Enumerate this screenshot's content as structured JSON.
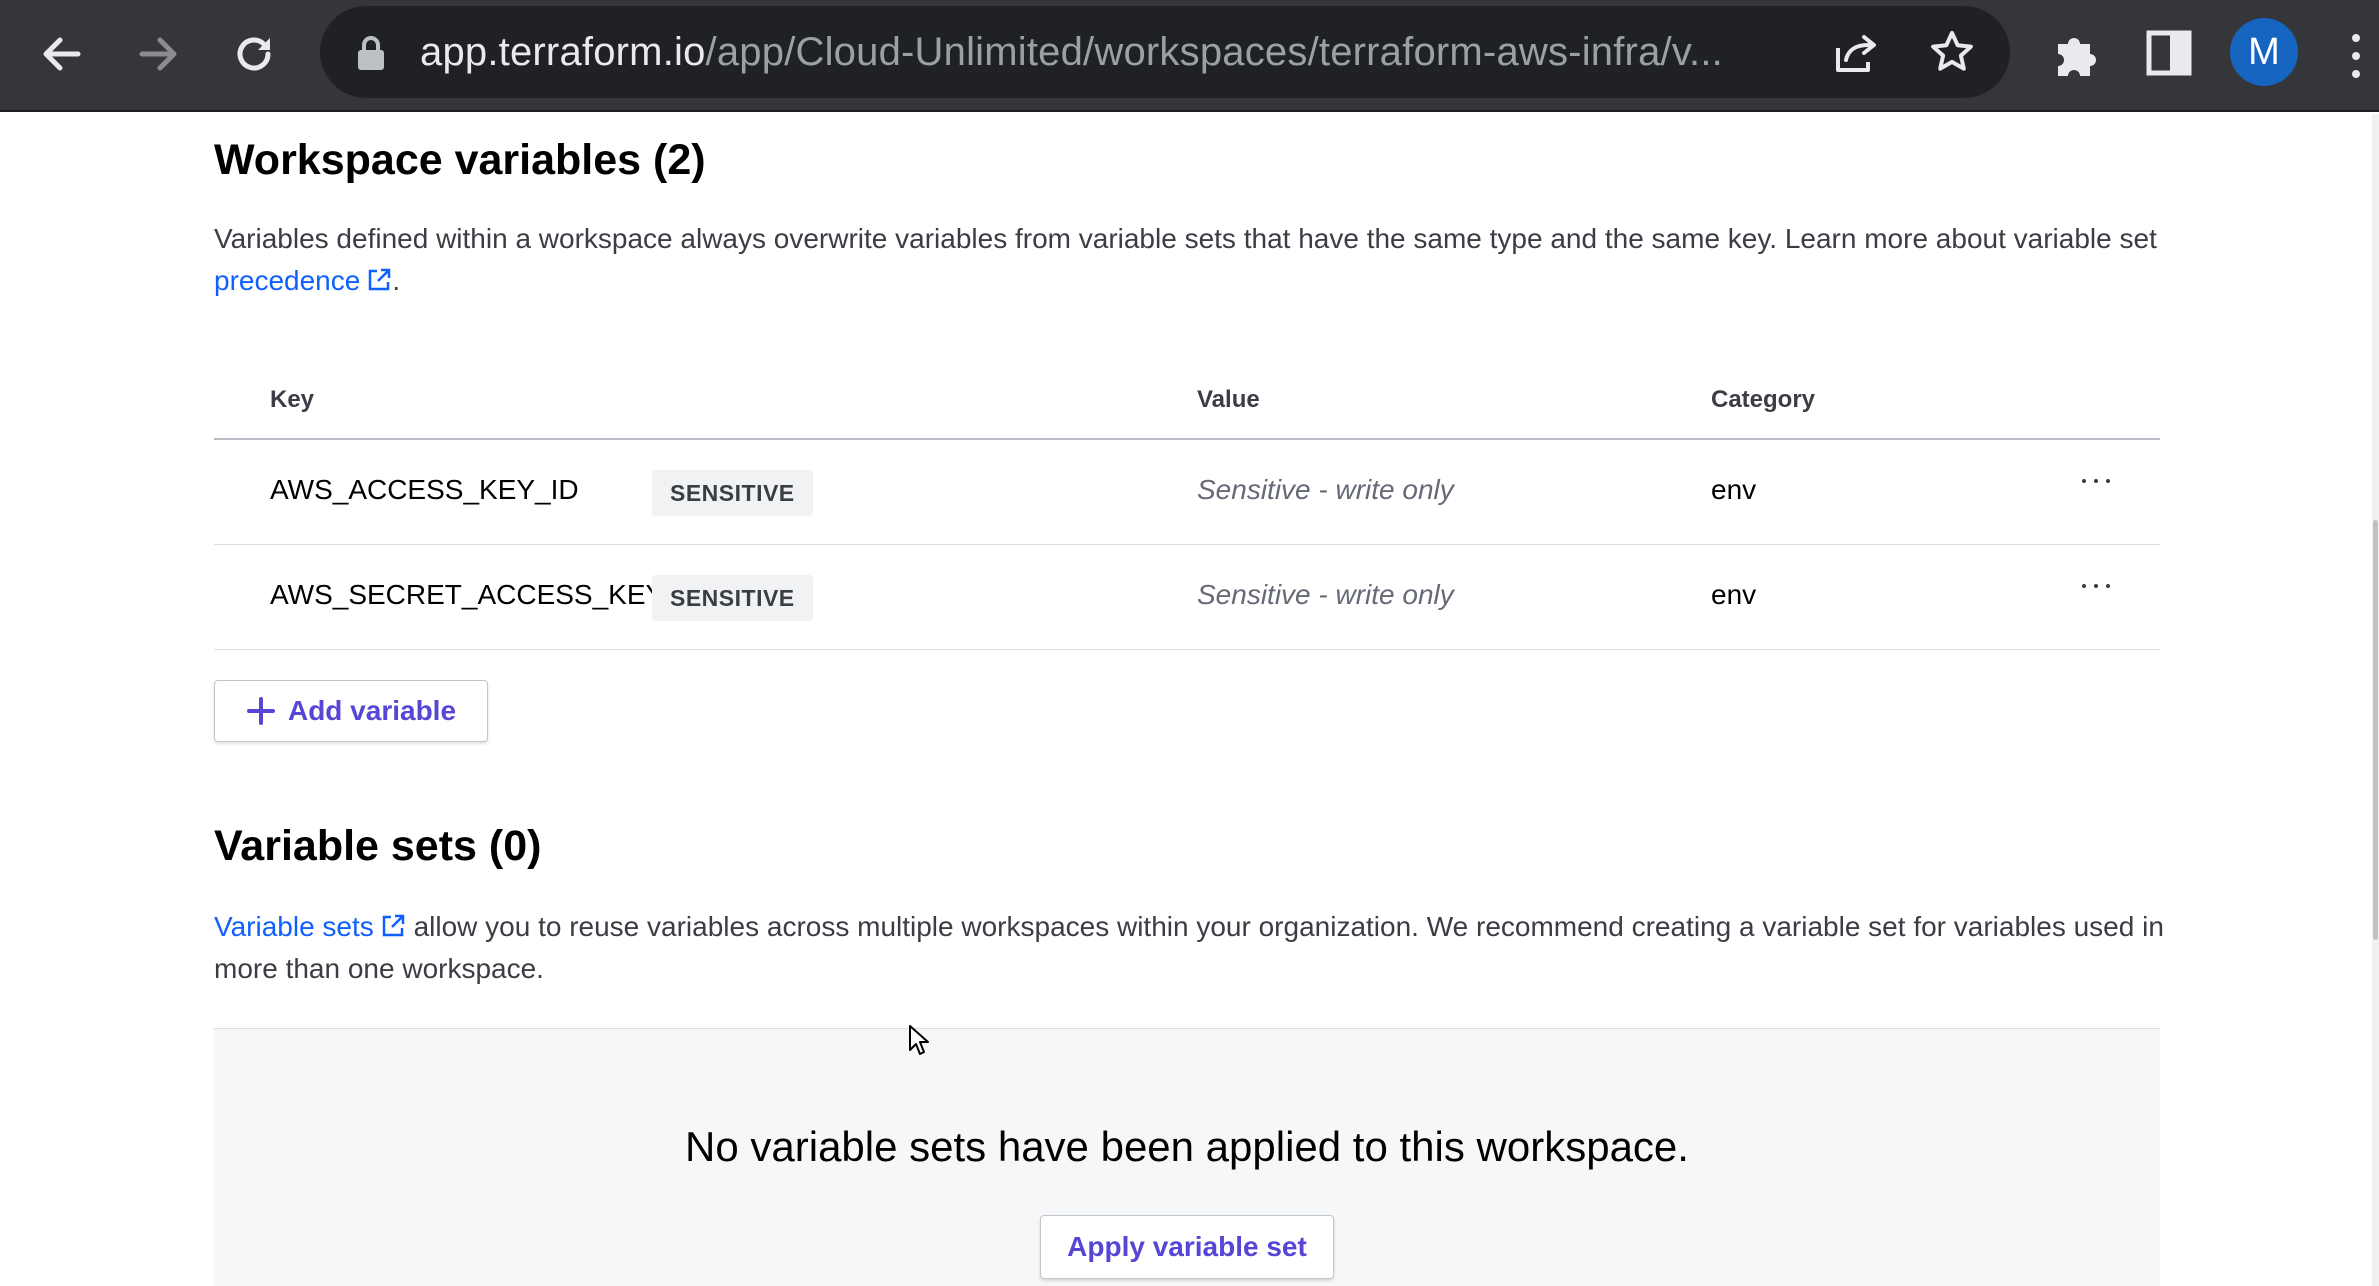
{
  "browser": {
    "url_host": "app.terraform.io",
    "url_path": "/app/Cloud-Unlimited/workspaces/terraform-aws-infra/v...",
    "avatar_letter": "M",
    "icons": [
      "back-arrow-icon",
      "forward-arrow-icon",
      "reload-icon",
      "lock-icon",
      "share-icon",
      "star-icon",
      "extensions-icon",
      "side-panel-icon",
      "more-vert-icon"
    ]
  },
  "workspace_variables": {
    "title": "Workspace variables (2)",
    "description": "Variables defined within a workspace always overwrite variables from variable sets that have the same type and the same key. Learn more about variable set",
    "link_text": "precedence",
    "trailing": ".",
    "columns": {
      "key": "Key",
      "value": "Value",
      "category": "Category"
    },
    "rows": [
      {
        "key": "AWS_ACCESS_KEY_ID",
        "badge": "SENSITIVE",
        "value": "Sensitive - write only",
        "category": "env"
      },
      {
        "key": "AWS_SECRET_ACCESS_KEY",
        "badge": "SENSITIVE",
        "value": "Sensitive - write only",
        "category": "env"
      }
    ],
    "add_button": "Add variable"
  },
  "variable_sets": {
    "title": "Variable sets (0)",
    "link_text": "Variable sets",
    "description": " allow you to reuse variables across multiple workspaces within your organization. We recommend creating a variable set for variables used in more than one workspace.",
    "empty_title": "No variable sets have been applied to this workspace.",
    "apply_button": "Apply variable set"
  },
  "colors": {
    "link": "#1060ff",
    "button_text": "#5746d6",
    "chrome_bg": "#35363a",
    "avatar_bg": "#1565c0"
  }
}
